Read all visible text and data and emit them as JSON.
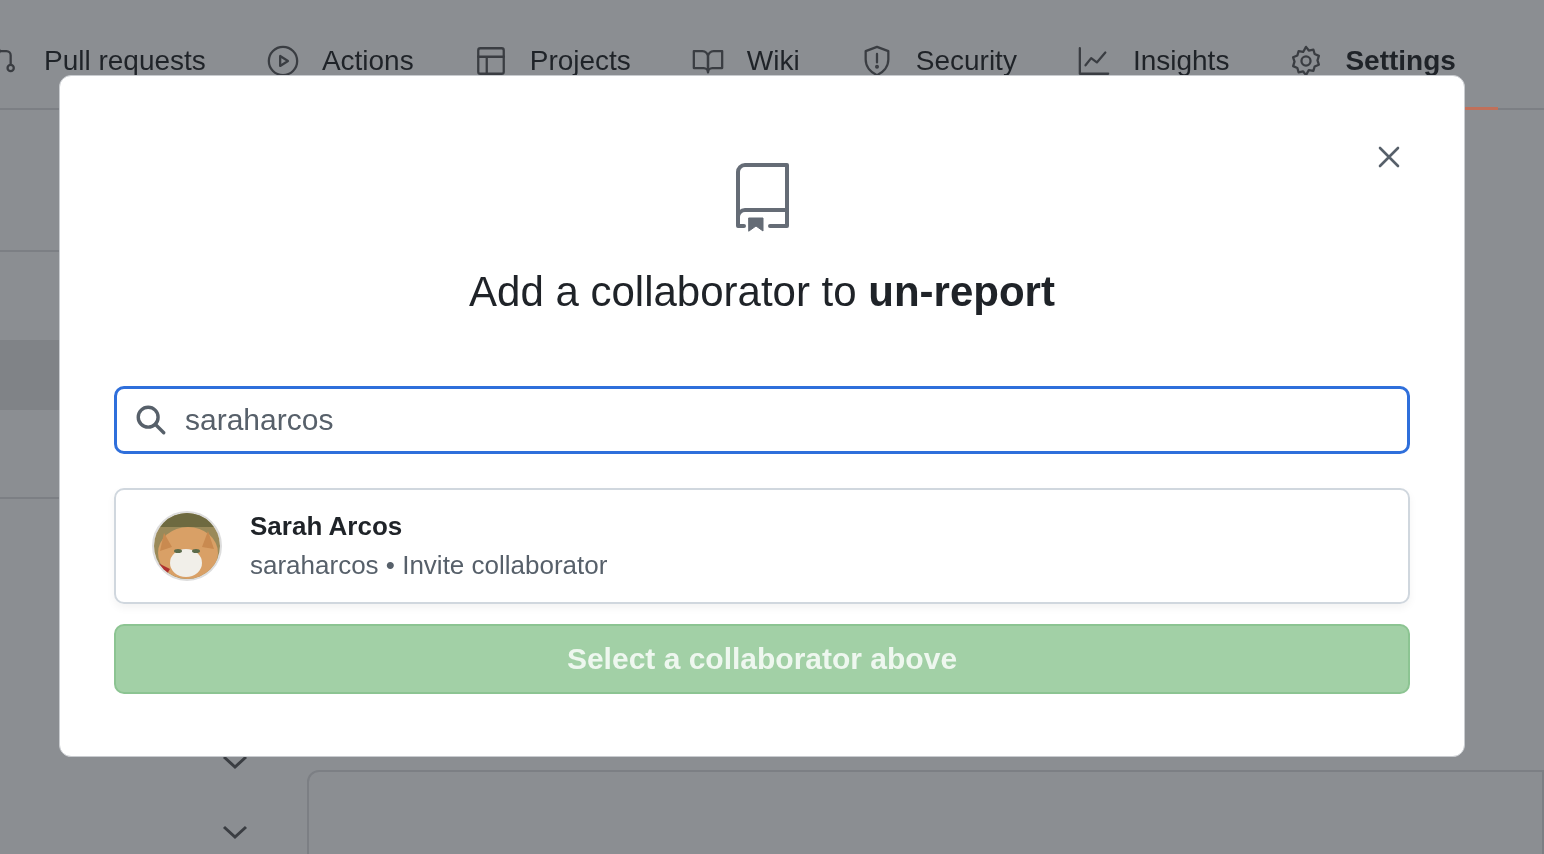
{
  "tabs": [
    {
      "label": "Pull requests",
      "selected": false
    },
    {
      "label": "Actions",
      "selected": false
    },
    {
      "label": "Projects",
      "selected": false
    },
    {
      "label": "Wiki",
      "selected": false
    },
    {
      "label": "Security",
      "selected": false
    },
    {
      "label": "Insights",
      "selected": false
    },
    {
      "label": "Settings",
      "selected": true
    }
  ],
  "dialog": {
    "title": "Add a collaborator to **un-report**",
    "search": {
      "value": "saraharcos"
    },
    "results": [
      {
        "name": "Sarah Arcos",
        "detail": "saraharcos • Invite collaborator"
      }
    ],
    "submit": {
      "label": "Select a collaborator above",
      "disabled": true
    }
  }
}
